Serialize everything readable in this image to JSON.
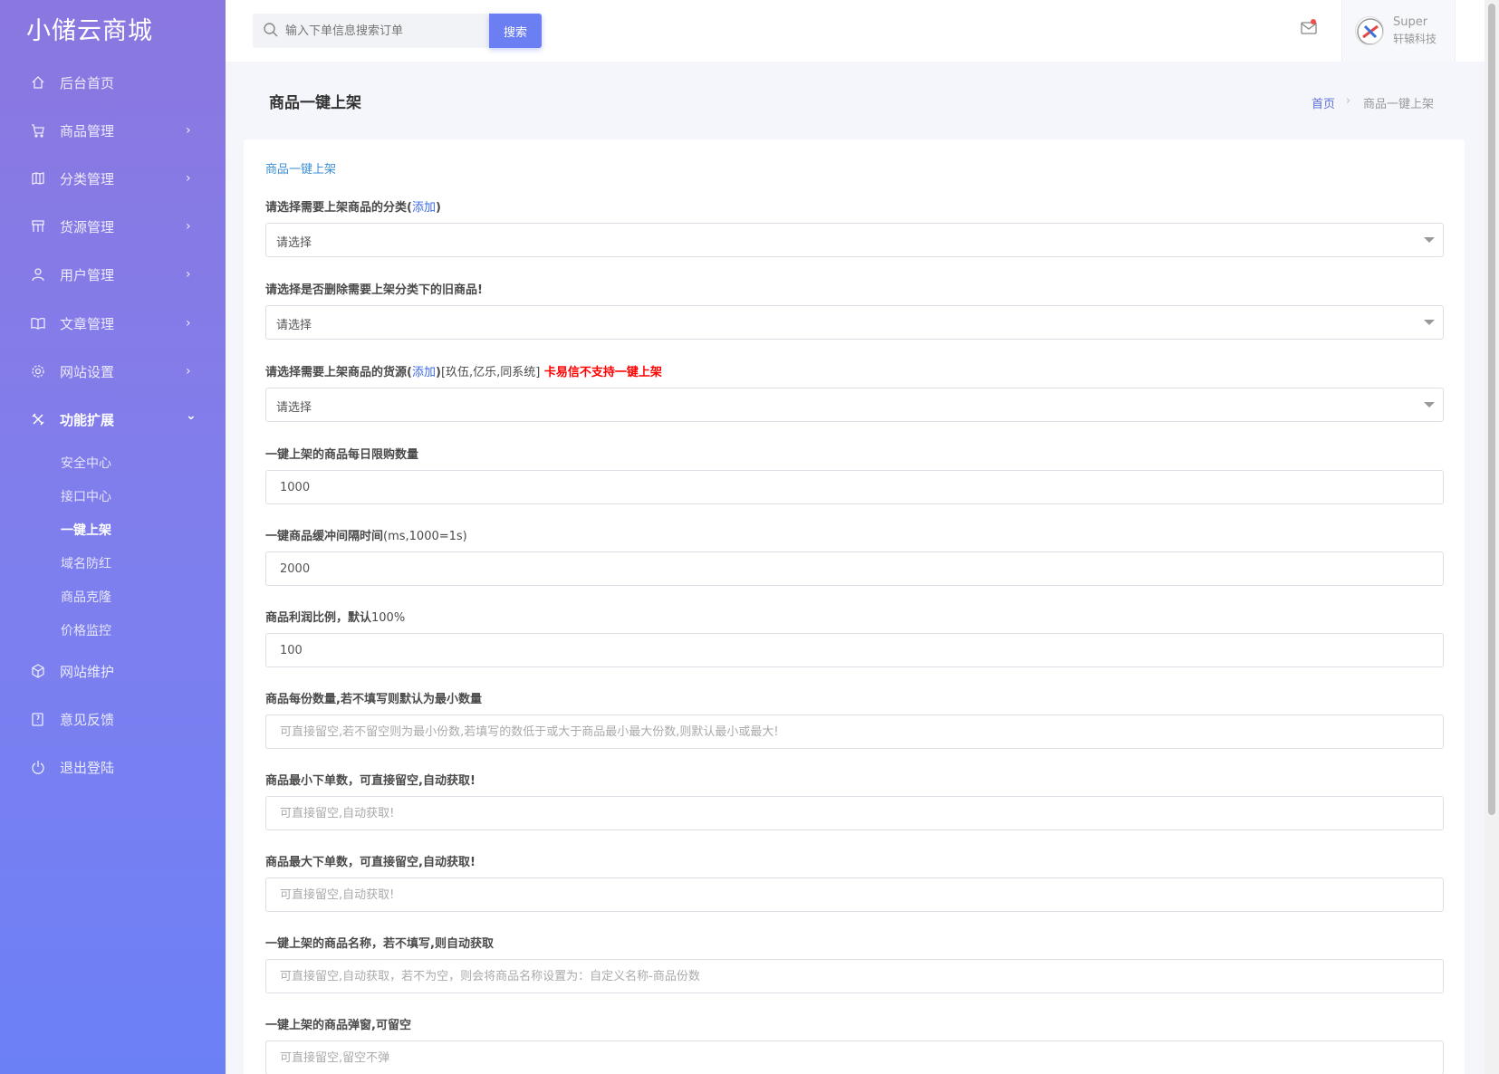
{
  "brand": "小储云商城",
  "nav": [
    {
      "label": "后台首页",
      "icon": "home-icon",
      "chev": ""
    },
    {
      "label": "商品管理",
      "icon": "cart-icon",
      "chev": "›"
    },
    {
      "label": "分类管理",
      "icon": "map-icon",
      "chev": "›"
    },
    {
      "label": "货源管理",
      "icon": "grid-icon",
      "chev": "›"
    },
    {
      "label": "用户管理",
      "icon": "user-icon",
      "chev": "›"
    },
    {
      "label": "文章管理",
      "icon": "book-icon",
      "chev": "›"
    },
    {
      "label": "网站设置",
      "icon": "gear-icon",
      "chev": "›"
    },
    {
      "label": "功能扩展",
      "icon": "tools-icon",
      "chev": "⌄"
    }
  ],
  "subnav": [
    "安全中心",
    "接口中心",
    "一键上架",
    "域名防红",
    "商品克隆",
    "价格监控"
  ],
  "nav_bottom": [
    {
      "label": "网站维护",
      "icon": "box-icon"
    },
    {
      "label": "意见反馈",
      "icon": "feedback-icon"
    },
    {
      "label": "退出登陆",
      "icon": "power-icon"
    }
  ],
  "search": {
    "placeholder": "输入下单信息搜索订单",
    "button": "搜索"
  },
  "user": {
    "name": "Super",
    "org": "轩辕科技"
  },
  "page": {
    "title": "商品一键上架",
    "crumb_home": "首页",
    "crumb_sep": "›",
    "crumb_current": "商品一键上架"
  },
  "form": {
    "card_title": "商品一键上架",
    "category_label": "请选择需要上架商品的分类",
    "category_add": "添加",
    "category_select": "请选择",
    "delete_label": "请选择是否删除需要上架分类下的旧商品!",
    "delete_select": "请选择",
    "source_label": "请选择需要上架商品的货源",
    "source_add": "添加",
    "source_note": "[玖伍,亿乐,同系统]",
    "source_warn": "卡易信不支持一键上架",
    "source_select": "请选择",
    "limit_label": "一键上架的商品每日限购数量",
    "limit_value": "1000",
    "interval_label": "一键商品缓冲间隔时间",
    "interval_note": "(ms,1000=1s)",
    "interval_value": "2000",
    "profit_label": "商品利润比例，默认",
    "profit_note": "100%",
    "profit_value": "100",
    "qty_label": "商品每份数量,若不填写则默认为最小数量",
    "qty_placeholder": "可直接留空,若不留空则为最小份数,若填写的数低于或大于商品最小最大份数,则默认最小或最大!",
    "min_label": "商品最小下单数，可直接留空,自动获取!",
    "min_placeholder": "可直接留空,自动获取!",
    "max_label": "商品最大下单数，可直接留空,自动获取!",
    "max_placeholder": "可直接留空,自动获取!",
    "name_label": "一键上架的商品名称，若不填写,则自动获取",
    "name_placeholder": "可直接留空,自动获取，若不为空，则会将商品名称设置为：自定义名称-商品份数",
    "popup_label": "一键上架的商品弹窗,可留空",
    "popup_placeholder": "可直接留空,留空不弹"
  }
}
